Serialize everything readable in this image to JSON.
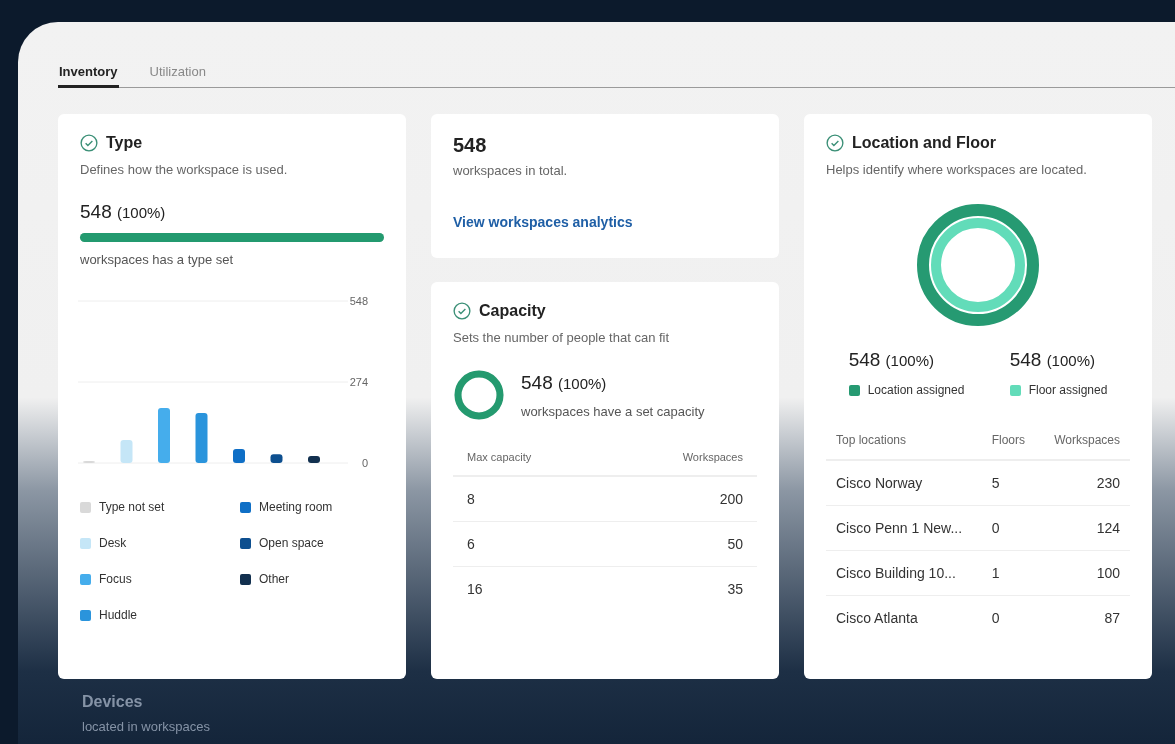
{
  "tabs": [
    {
      "label": "Inventory",
      "selected": true
    },
    {
      "label": "Utilization",
      "selected": false
    }
  ],
  "type_card": {
    "title": "Type",
    "description": "Defines how the workspace is used.",
    "count": "548",
    "percent": "(100%)",
    "level": 1,
    "caption": "workspaces has a type set",
    "chart_data": {
      "type": "bar",
      "ylim": [
        0,
        548
      ],
      "yticks": [
        548,
        274,
        0
      ],
      "series": [
        {
          "name": "Type not set",
          "color": "#d9d9d9",
          "values": [
            2
          ]
        },
        {
          "name": "Desk",
          "color": "#c5e6f7",
          "values": [
            78
          ]
        },
        {
          "name": "Focus",
          "color": "#45adec",
          "values": [
            186
          ]
        },
        {
          "name": "Huddle",
          "color": "#2a94dc",
          "values": [
            169
          ]
        },
        {
          "name": "Meeting room",
          "color": "#0f6fc6",
          "values": [
            47
          ]
        },
        {
          "name": "Open space",
          "color": "#0d4f8f",
          "values": [
            30
          ]
        },
        {
          "name": "Other",
          "color": "#12304f",
          "values": [
            24
          ]
        }
      ]
    }
  },
  "total_card": {
    "count": "548",
    "caption": "workspaces in total.",
    "link": "View workspaces analytics"
  },
  "capacity_card": {
    "title": "Capacity",
    "description": "Sets the number of people that can fit",
    "count": "548",
    "percent": "(100%)",
    "level": 1,
    "caption": "workspaces have a set capacity",
    "columns": [
      "Max capacity",
      "Workspaces"
    ],
    "rows": [
      [
        "8",
        "200"
      ],
      [
        "6",
        "50"
      ],
      [
        "16",
        "35"
      ]
    ]
  },
  "location_card": {
    "title": "Location and Floor",
    "description": "Helps identify where workspaces are located.",
    "stats": [
      {
        "count": "548",
        "percent": "(100%)",
        "label": "Location assigned",
        "color": "#269a72",
        "level": 1
      },
      {
        "count": "548",
        "percent": "(100%)",
        "label": "Floor assigned",
        "color": "#62dcb9",
        "level": 1
      }
    ],
    "columns": [
      "Top locations",
      "Floors",
      "Workspaces"
    ],
    "rows": [
      [
        "Cisco Norway",
        "5",
        "230"
      ],
      [
        "Cisco Penn 1 New...",
        "0",
        "124"
      ],
      [
        "Cisco Building 10...",
        "1",
        "100"
      ],
      [
        "Cisco Atlanta",
        "0",
        "87"
      ]
    ]
  },
  "devices": {
    "title": "Devices",
    "caption": "located in workspaces"
  }
}
